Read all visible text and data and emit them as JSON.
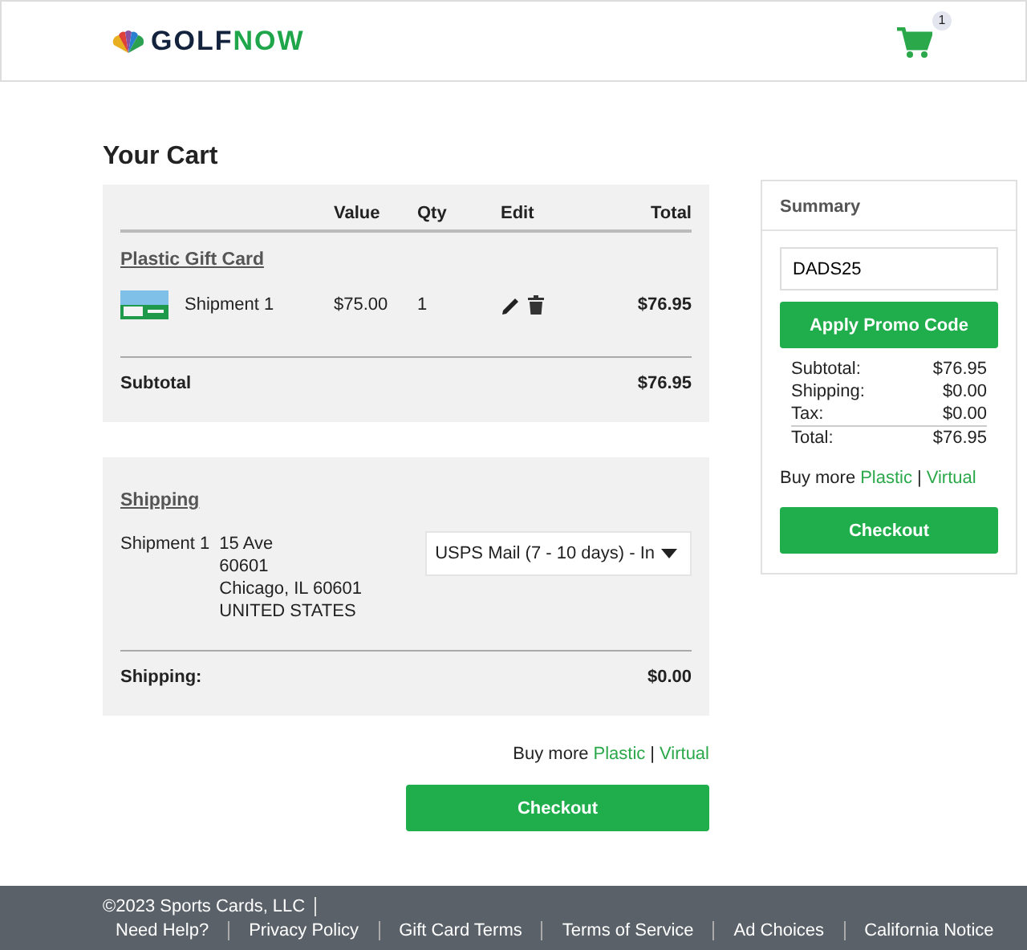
{
  "header": {
    "logo": {
      "part1": "GOLF",
      "part2": "NOW"
    },
    "cart_count": "1"
  },
  "title": "Your Cart",
  "cart": {
    "columns": [
      "Value",
      "Qty",
      "Edit",
      "Total"
    ],
    "product": "Plastic Gift Card",
    "items": [
      {
        "name": "Shipment 1",
        "value": "$75.00",
        "qty": "1",
        "total": "$76.95"
      }
    ],
    "subtotal_label": "Subtotal",
    "subtotal": "$76.95"
  },
  "shipping": {
    "title": "Shipping",
    "shipment": "Shipment 1",
    "address": [
      "15 Ave",
      "60601",
      "Chicago, IL 60601",
      "UNITED STATES"
    ],
    "method": "USPS Mail (7 - 10 days) - In",
    "total_label": "Shipping:",
    "total": "$0.00"
  },
  "buy_more": {
    "text": "Buy more",
    "links": [
      "Plastic",
      "Virtual"
    ],
    "separator": "|"
  },
  "checkout": "Checkout",
  "summary": {
    "title": "Summary",
    "promo_value": "DADS25",
    "apply": "Apply Promo Code",
    "lines": [
      {
        "label": "Subtotal:",
        "value": "$76.95"
      },
      {
        "label": "Shipping:",
        "value": "$0.00"
      },
      {
        "label": "Tax:",
        "value": "$0.00"
      },
      {
        "label": "Total:",
        "value": "$76.95"
      }
    ],
    "buy_more": {
      "text": "Buy more",
      "links": [
        "Plastic",
        "Virtual"
      ],
      "separator": "|"
    },
    "checkout": "Checkout"
  },
  "footer": {
    "copyright": "©2023 Sports Cards, LLC",
    "links": [
      "Need Help?",
      "Privacy Policy",
      "Gift Card Terms",
      "Terms of Service",
      "Ad Choices",
      "California Notice"
    ]
  }
}
